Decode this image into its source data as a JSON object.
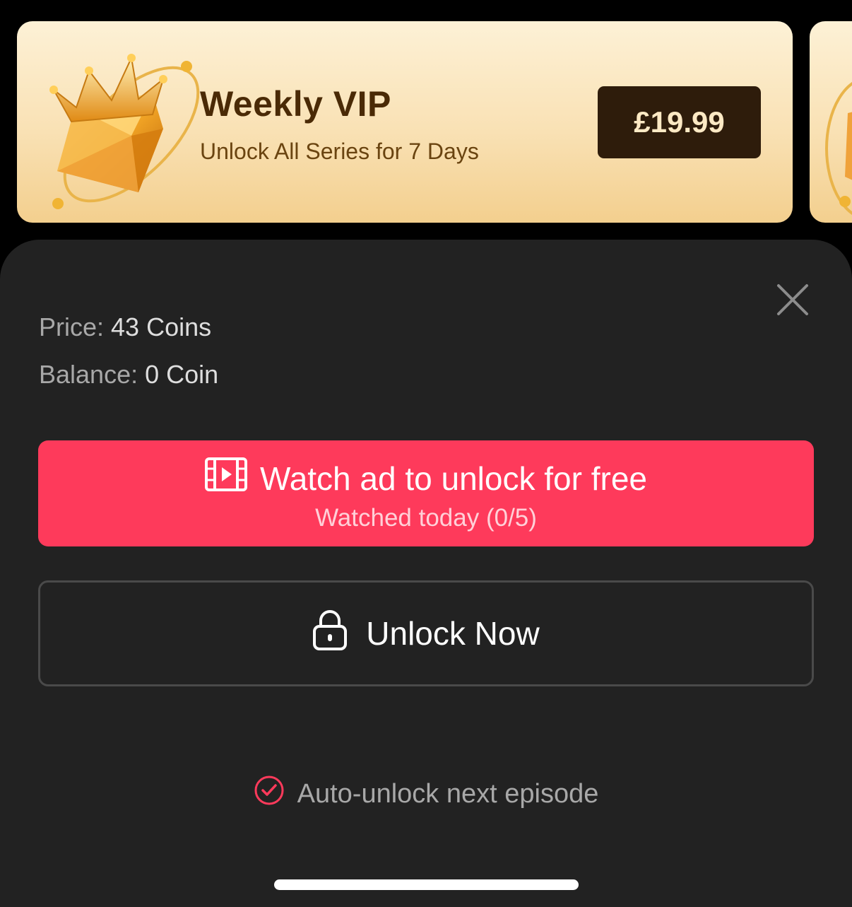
{
  "vip": {
    "title": "Weekly VIP",
    "subtitle": "Unlock All Series for 7 Days",
    "price": "£19.99",
    "icon": "crown-gem-icon"
  },
  "sheet": {
    "price_label": "Price: ",
    "price_value": "43 Coins",
    "balance_label": "Balance: ",
    "balance_value": "0 Coin",
    "ad_button": {
      "label": "Watch ad to unlock for free",
      "sublabel": "Watched today (0/5)",
      "icon": "film-play-icon"
    },
    "unlock_button": {
      "label": "Unlock Now",
      "icon": "lock-icon"
    },
    "auto_unlock": {
      "label": "Auto-unlock next episode",
      "checked": true,
      "icon": "check-circle-icon"
    },
    "close_icon": "close-icon"
  },
  "colors": {
    "accent": "#fe3a5b",
    "sheet_bg": "#222222",
    "vip_text": "#4a2a06",
    "price_bg": "#2e1c0b"
  }
}
